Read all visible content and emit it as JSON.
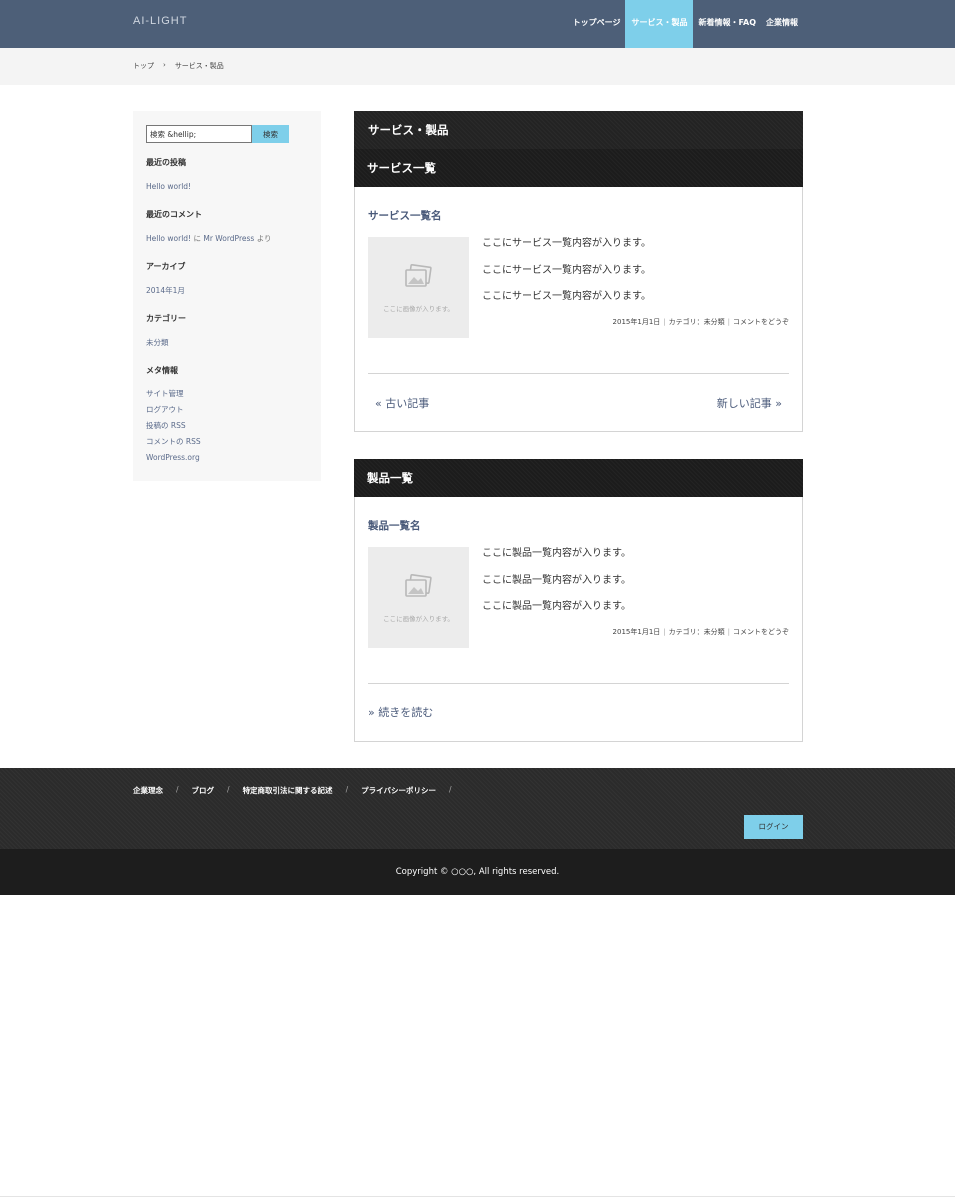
{
  "header": {
    "logo": "AI-LIGHT",
    "nav": [
      {
        "label": "トップページ",
        "active": false
      },
      {
        "label": "サービス・製品",
        "active": true
      },
      {
        "label": "新着情報・FAQ",
        "active": false
      },
      {
        "label": "企業情報",
        "active": false
      }
    ]
  },
  "breadcrumb": {
    "home": "トップ",
    "sep": "›",
    "current": "サービス・製品"
  },
  "sidebar": {
    "search": {
      "value": "検索 &hellip;",
      "button": "検索"
    },
    "recent_posts": {
      "title": "最近の投稿",
      "items": [
        "Hello world!"
      ]
    },
    "recent_comments": {
      "title": "最近のコメント",
      "post": "Hello world!",
      "on": "に",
      "author": "Mr WordPress",
      "suffix": "より"
    },
    "archives": {
      "title": "アーカイブ",
      "items": [
        "2014年1月"
      ]
    },
    "categories": {
      "title": "カテゴリー",
      "items": [
        "未分類"
      ]
    },
    "meta": {
      "title": "メタ情報",
      "items": [
        "サイト管理",
        "ログアウト",
        "投稿の RSS",
        "コメントの RSS",
        "WordPress.org"
      ]
    }
  },
  "main": {
    "page_title": "サービス・製品",
    "services": {
      "heading": "サービス一覧",
      "entry_title": "サービス一覧名",
      "thumb_text": "ここに画像が入ります。",
      "lines": [
        "ここにサービス一覧内容が入ります。",
        "ここにサービス一覧内容が入ります。",
        "ここにサービス一覧内容が入ります。"
      ],
      "date": "2015年1月1日",
      "category_label": "カテゴリ：",
      "category": "未分類",
      "comment_link": "コメントをどうぞ",
      "older": "« 古い記事",
      "newer": "新しい記事 »"
    },
    "products": {
      "heading": "製品一覧",
      "entry_title": "製品一覧名",
      "thumb_text": "ここに画像が入ります。",
      "lines": [
        "ここに製品一覧内容が入ります。",
        "ここに製品一覧内容が入ります。",
        "ここに製品一覧内容が入ります。"
      ],
      "date": "2015年1月1日",
      "category_label": "カテゴリ：",
      "category": "未分類",
      "comment_link": "コメントをどうぞ",
      "more": "» 続きを読む"
    }
  },
  "footer": {
    "links": [
      "企業理念",
      "ブログ",
      "特定商取引法に関する記述",
      "プライバシーポリシー"
    ],
    "slash": "/",
    "login": "ログイン",
    "copyright": "Copyright © ○○○, All rights reserved."
  },
  "colors": {
    "header_bg": "#4d5f78",
    "accent": "#7ecfea",
    "dark": "#1c1c1c"
  }
}
